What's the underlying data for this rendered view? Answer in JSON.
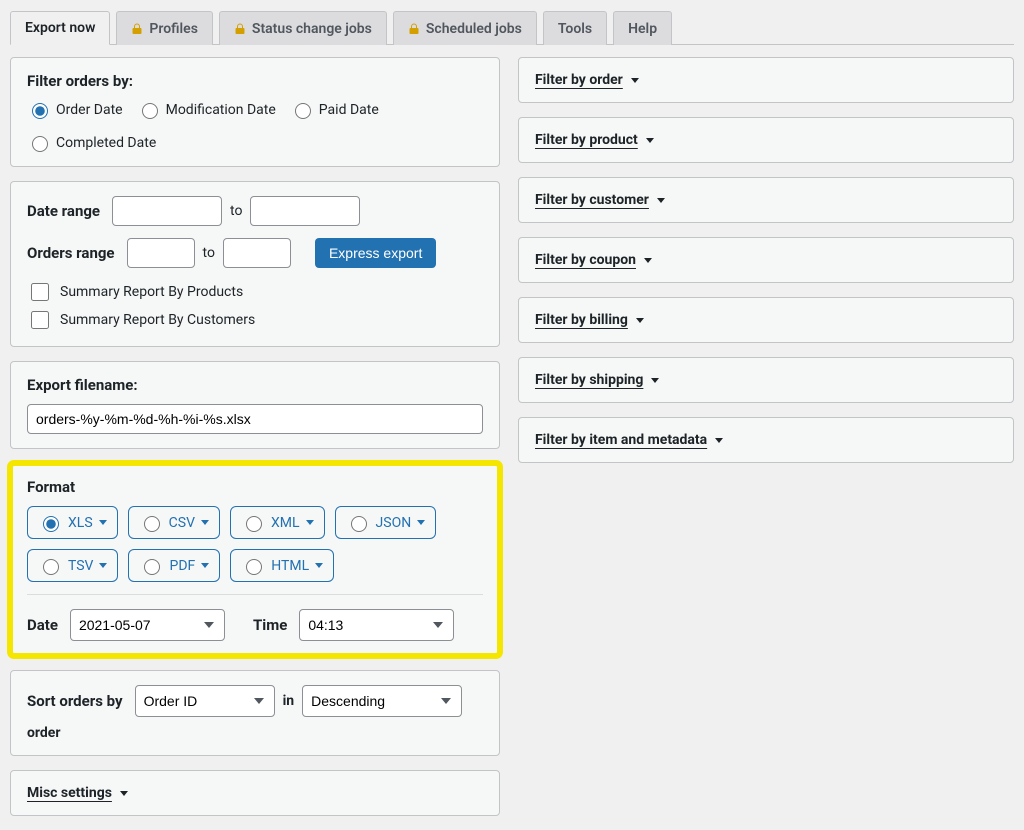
{
  "tabs": {
    "export_now": "Export now",
    "profiles": "Profiles",
    "status_change": "Status change jobs",
    "scheduled": "Scheduled jobs",
    "tools": "Tools",
    "help": "Help"
  },
  "filter_orders": {
    "title": "Filter orders by:",
    "options": {
      "order_date": "Order Date",
      "modification_date": "Modification Date",
      "paid_date": "Paid Date",
      "completed_date": "Completed Date"
    }
  },
  "date_range": {
    "label": "Date range",
    "to": "to"
  },
  "orders_range": {
    "label": "Orders range",
    "to": "to",
    "button": "Express export",
    "summary_products": "Summary Report By Products",
    "summary_customers": "Summary Report By Customers"
  },
  "filename": {
    "label": "Export filename:",
    "value": "orders-%y-%m-%d-%h-%i-%s.xlsx"
  },
  "format": {
    "title": "Format",
    "xls": "XLS",
    "csv": "CSV",
    "xml": "XML",
    "json": "JSON",
    "tsv": "TSV",
    "pdf": "PDF",
    "html": "HTML",
    "date_label": "Date",
    "date_value": "2021-05-07",
    "time_label": "Time",
    "time_value": "04:13"
  },
  "sort": {
    "label": "Sort orders by",
    "orderby": "Order ID",
    "in": "in",
    "order": "Descending",
    "suffix": "order"
  },
  "misc": "Misc settings",
  "right_filters": {
    "order": "Filter by order",
    "product": "Filter by product",
    "customer": "Filter by customer",
    "coupon": "Filter by coupon",
    "billing": "Filter by billing",
    "shipping": "Filter by shipping",
    "item_meta": "Filter by item and metadata"
  }
}
